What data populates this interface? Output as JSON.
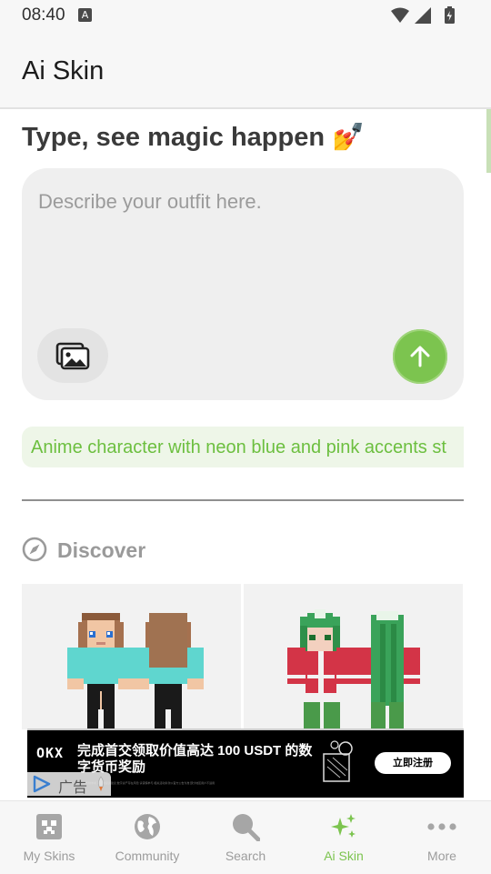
{
  "status_bar": {
    "time": "08:40",
    "badge": "A"
  },
  "app_bar": {
    "title": "Ai Skin"
  },
  "main": {
    "headline": "Type, see magic happen 💅",
    "prompt": {
      "placeholder": "Describe your outfit here.",
      "value": ""
    },
    "suggestion": "Anime character with neon blue and pink accents st",
    "discover": {
      "label": "Discover"
    }
  },
  "ad": {
    "logo": "OKX",
    "title": "完成首交领取价值高达 100 USDT 的数字货币奖励",
    "fine_print": "本广告仅供参考 不构成投资建议 数字资产存在风险 请谨慎参与 相关活动条款以官方公告为准 部分地区用户不适用",
    "cta": "立即注册",
    "tag": "广告"
  },
  "bottom_nav": {
    "items": [
      {
        "label": "My Skins",
        "icon": "my-skins-icon",
        "active": false
      },
      {
        "label": "Community",
        "icon": "globe-icon",
        "active": false
      },
      {
        "label": "Search",
        "icon": "search-icon",
        "active": false
      },
      {
        "label": "Ai Skin",
        "icon": "sparkles-icon",
        "active": true
      },
      {
        "label": "More",
        "icon": "more-dots-icon",
        "active": false
      }
    ]
  },
  "colors": {
    "accent": "#7cc44f",
    "chip_bg": "#eef6e8",
    "prompt_bg": "#efefef"
  }
}
